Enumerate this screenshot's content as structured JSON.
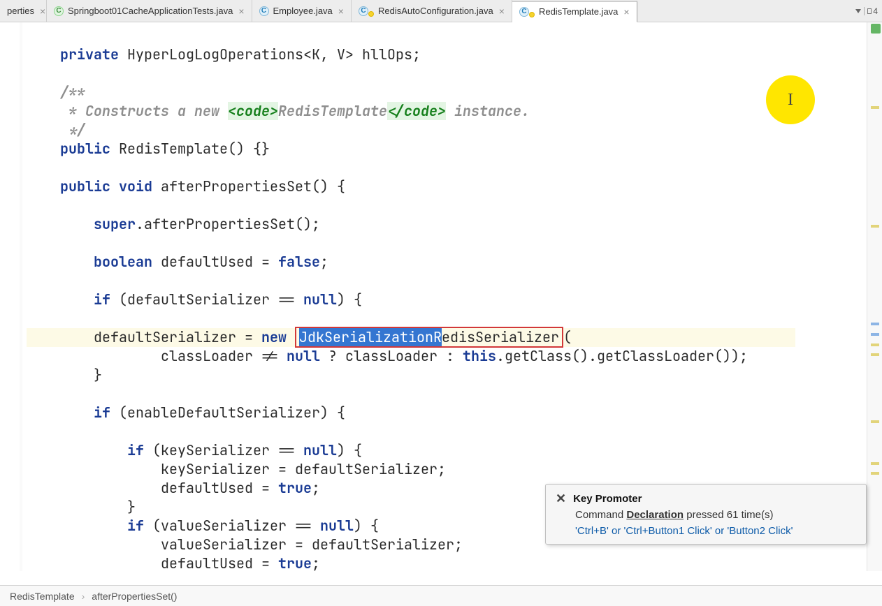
{
  "tabs": [
    {
      "label": "perties",
      "icon": "green",
      "locked": false
    },
    {
      "label": "Springboot01CacheApplicationTests.java",
      "icon": "green",
      "locked": false
    },
    {
      "label": "Employee.java",
      "icon": "blue",
      "locked": false
    },
    {
      "label": "RedisAutoConfiguration.java",
      "icon": "blue",
      "locked": true
    },
    {
      "label": "RedisTemplate.java",
      "icon": "blue",
      "locked": true
    }
  ],
  "splitter_label": "4",
  "code": {
    "l1a": "private",
    "l1b": " HyperLogLogOperations<K, V> hllOps;",
    "l2a": "/**",
    "l2b": " * Constructs a new ",
    "l2tag1": "<code>",
    "l2txt": "RedisTemplate",
    "l2tag2": "</code>",
    "l2c": " instance.",
    "l2d": " */",
    "l3a": "public",
    "l3b": " RedisTemplate() {}",
    "l4a": "public",
    "l4b": "void",
    "l4c": " afterPropertiesSet() {",
    "l5a": "super",
    "l5b": ".afterPropertiesSet();",
    "l6a": "boolean",
    "l6b": " defaultUsed = ",
    "l6c": "false",
    "l6d": ";",
    "l7a": "if",
    "l7b": " (defaultSerializer == ",
    "l7c": "null",
    "l7d": ") {",
    "l8pre": "        defaultSerializer = ",
    "l8new": "new ",
    "l8sel": "JdkSerializationR",
    "l8rest": "edisSerializer",
    "l8open": "(",
    "l9a": "            classLoader != ",
    "l9b": "null",
    "l9c": " ? classLoader : ",
    "l9d": "this",
    "l9e": ".getClass().getClassLoader());",
    "l10": "}",
    "l11a": "if",
    "l11b": " (enableDefaultSerializer) {",
    "l12a": "if",
    "l12b": " (keySerializer == ",
    "l12c": "null",
    "l12d": ") {",
    "l13": "keySerializer = defaultSerializer;",
    "l14a": "defaultUsed = ",
    "l14b": "true",
    "l14c": ";",
    "l15": "}",
    "l16a": "if",
    "l16b": " (valueSerializer == ",
    "l16c": "null",
    "l16d": ") {",
    "l17": "valueSerializer = defaultSerializer;",
    "l18a": "defaultUsed = ",
    "l18b": "true",
    "l18c": ";",
    "l19": "}"
  },
  "popup": {
    "title": "Key Promoter",
    "cmd_prefix": "Command ",
    "cmd_name": "Declaration",
    "cmd_suffix": " pressed 61 time(s)",
    "hint1": "'Ctrl+B'",
    "hint_or": " or ",
    "hint2": "'Ctrl+Button1 Click'",
    "hint3": "'Button2 Click'"
  },
  "breadcrumb": {
    "a": "RedisTemplate",
    "b": "afterPropertiesSet()"
  },
  "cursor_glyph": "I"
}
